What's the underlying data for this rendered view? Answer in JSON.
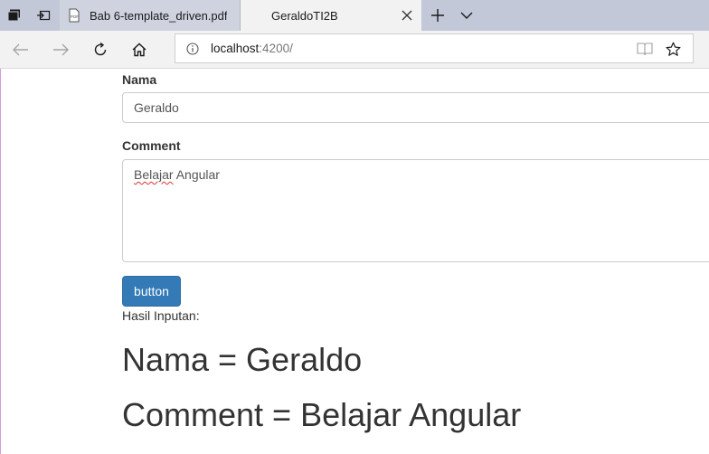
{
  "browser": {
    "tabs": [
      {
        "title": "Bab 6-template_driven.pdf",
        "icon": "pdf-icon",
        "active": false
      },
      {
        "title": "GeraldoTI2B",
        "active": true
      }
    ],
    "address": {
      "host": "localhost",
      "rest": ":4200/"
    },
    "icons": {
      "set_aside": "tabs-aside-icon",
      "show_aside": "tabs-restore-icon",
      "back": "back-arrow-icon",
      "forward": "forward-arrow-icon",
      "refresh": "refresh-icon",
      "home": "home-icon",
      "info": "info-icon",
      "reading_view": "reading-view-icon",
      "favorite": "star-icon",
      "new_tab": "plus-icon",
      "tab_list": "chevron-down-icon",
      "close": "close-icon"
    }
  },
  "form": {
    "nama_label": "Nama",
    "nama_value": "Geraldo",
    "comment_label": "Comment",
    "comment_misspelled": "Belajar",
    "comment_rest": " Angular",
    "button_label": "button"
  },
  "result": {
    "heading": "Hasil Inputan:",
    "nama_line": "Nama = Geraldo",
    "comment_line": "Comment = Belajar Angular"
  },
  "colors": {
    "primary_button": "#337ab7",
    "tabbar": "#c3c8d9",
    "text": "#333333"
  }
}
